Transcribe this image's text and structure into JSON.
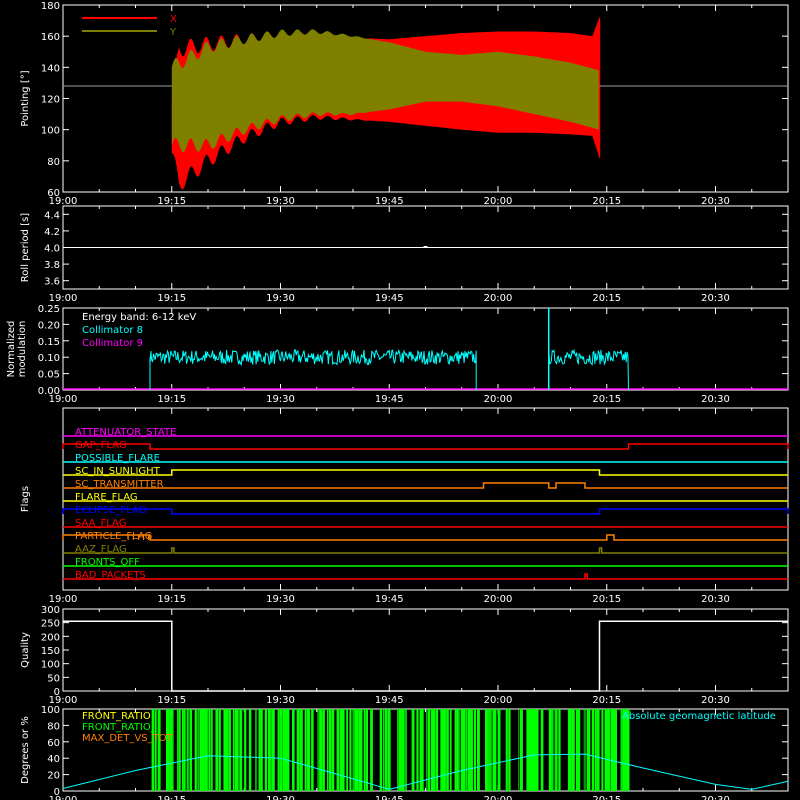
{
  "time_axis": {
    "start": "19:00",
    "end": "20:40",
    "tick_labels": [
      "19:00",
      "19:15",
      "19:30",
      "19:45",
      "20:00",
      "20:15",
      "20:30"
    ]
  },
  "colors": {
    "bg": "#000000",
    "axis": "#ffffff",
    "red": "#ff0000",
    "olive": "#808000",
    "cyan": "#00ffff",
    "magenta": "#ff00ff",
    "green": "#00ff00",
    "yellow": "#ffff00",
    "orange": "#ff8000",
    "blue": "#0000ff",
    "white": "#ffffff"
  },
  "chart_data": [
    {
      "id": "pointing",
      "type": "area",
      "ylabel": "Pointing [°]",
      "ylim": [
        60,
        180
      ],
      "ytick_labels": [
        "60",
        "80",
        "100",
        "120",
        "140",
        "160",
        "180"
      ],
      "legend": [
        {
          "name": "X",
          "color": "#ff0000"
        },
        {
          "name": "Y",
          "color": "#808000"
        }
      ],
      "reference_line": 128,
      "x_envelope": {
        "x": [
          "19:15",
          "19:16",
          "19:20",
          "19:25",
          "19:30",
          "19:35",
          "19:45",
          "19:55",
          "20:00",
          "20:05",
          "20:10",
          "20:13",
          "20:14"
        ],
        "upper": [
          120,
          152,
          155,
          158,
          160,
          160,
          158,
          162,
          163,
          163,
          162,
          160,
          172
        ],
        "lower": [
          85,
          65,
          80,
          95,
          105,
          108,
          105,
          100,
          98,
          98,
          97,
          96,
          82
        ]
      },
      "y_envelope": {
        "x": [
          "19:15",
          "19:20",
          "19:25",
          "19:30",
          "19:35",
          "19:40",
          "19:45",
          "19:50",
          "19:55",
          "20:00",
          "20:05",
          "20:10",
          "20:14"
        ],
        "upper": [
          140,
          153,
          158,
          162,
          163,
          160,
          156,
          150,
          148,
          150,
          147,
          143,
          138
        ],
        "lower": [
          90,
          90,
          100,
          107,
          110,
          110,
          113,
          118,
          118,
          115,
          110,
          105,
          100
        ]
      }
    },
    {
      "id": "roll",
      "type": "line",
      "ylabel": "Roll period [s]",
      "ylim": [
        3.5,
        4.5
      ],
      "ytick_labels": [
        "3.6",
        "3.8",
        "4.0",
        "4.2",
        "4.4"
      ],
      "x": [
        "19:00",
        "20:40"
      ],
      "y": [
        4.0,
        4.0
      ]
    },
    {
      "id": "modulation",
      "type": "line",
      "ylabel": "Normalized modulation",
      "ylim": [
        0,
        0.25
      ],
      "ytick_labels": [
        "0.00",
        "0.05",
        "0.10",
        "0.15",
        "0.20",
        "0.25"
      ],
      "annotation": "Energy band: 6-12 keV",
      "legend": [
        {
          "name": "Collimator 8",
          "color": "#00ffff"
        },
        {
          "name": "Collimator 9",
          "color": "#ff00ff"
        }
      ],
      "active_intervals": [
        [
          "19:12",
          "19:57"
        ],
        [
          "20:07",
          "20:18"
        ]
      ],
      "spike_at": "20:07",
      "level": 0.1
    },
    {
      "id": "flags",
      "type": "line",
      "ylabel": "Flags",
      "series": [
        {
          "name": "ATTENUATOR_STATE",
          "color": "#ff00ff",
          "high": []
        },
        {
          "name": "GAP_FLAG",
          "color": "#ff0000",
          "high": [
            [
              "19:00",
              "19:12"
            ],
            [
              "20:18",
              "20:40"
            ]
          ]
        },
        {
          "name": "POSSIBLE_FLARE",
          "color": "#00ffff",
          "high": []
        },
        {
          "name": "SC_IN_SUNLIGHT",
          "color": "#ffff00",
          "high": [
            [
              "19:15",
              "20:14"
            ]
          ]
        },
        {
          "name": "SC_TRANSMITTER",
          "color": "#ff8000",
          "high": [
            [
              "19:58",
              "20:07"
            ],
            [
              "20:08",
              "20:12"
            ]
          ]
        },
        {
          "name": "FLARE_FLAG",
          "color": "#ffff00",
          "high": []
        },
        {
          "name": "ECLIPSE_FLAG",
          "color": "#0000ff",
          "high": [
            [
              "19:00",
              "19:15"
            ],
            [
              "20:14",
              "20:40"
            ]
          ]
        },
        {
          "name": "SAA_FLAG",
          "color": "#ff0000",
          "high": []
        },
        {
          "name": "PARTICLE_FLAG",
          "color": "#ff8000",
          "high": [
            [
              "19:00",
              "19:12"
            ],
            [
              "20:15",
              "20:16"
            ]
          ]
        },
        {
          "name": "AAZ_FLAG",
          "color": "#808000",
          "high": [
            [
              "19:15",
              "19:15.3"
            ],
            [
              "20:14",
              "20:14.3"
            ]
          ]
        },
        {
          "name": "FRONTS_OFF",
          "color": "#00ff00",
          "high": []
        },
        {
          "name": "BAD_PACKETS",
          "color": "#ff0000",
          "high": [
            [
              "20:12",
              "20:12.3"
            ]
          ]
        }
      ]
    },
    {
      "id": "quality",
      "type": "line",
      "ylabel": "Quality",
      "ylim": [
        0,
        300
      ],
      "ytick_labels": [
        "0",
        "50",
        "100",
        "150",
        "200",
        "250",
        "300"
      ],
      "high_intervals": [
        [
          "19:00",
          "19:15"
        ],
        [
          "20:14",
          "20:40"
        ]
      ],
      "high_value": 255
    },
    {
      "id": "ratios",
      "type": "line",
      "ylabel": "Degrees or %",
      "ylim": [
        0,
        100
      ],
      "ytick_labels": [
        "0",
        "20",
        "40",
        "60",
        "80",
        "100"
      ],
      "legend": [
        {
          "name": "FRONT_RATIO",
          "color": "#ffff00"
        },
        {
          "name": "FRONT_RATIO_",
          "color": "#00ff00"
        },
        {
          "name": "MAX_DET_VS_TOT",
          "color": "#ff8000"
        }
      ],
      "right_label": "Absolute geomagnetic latitude",
      "right_label_color": "#00ffff",
      "green_interval": [
        "19:12",
        "20:18"
      ],
      "latitude": {
        "x": [
          "19:00",
          "19:10",
          "19:20",
          "19:30",
          "19:38",
          "19:45",
          "19:55",
          "20:05",
          "20:12",
          "20:20",
          "20:30",
          "20:35",
          "20:40"
        ],
        "y": [
          3,
          25,
          43,
          40,
          20,
          2,
          25,
          44,
          45,
          28,
          8,
          2,
          12
        ]
      }
    }
  ]
}
